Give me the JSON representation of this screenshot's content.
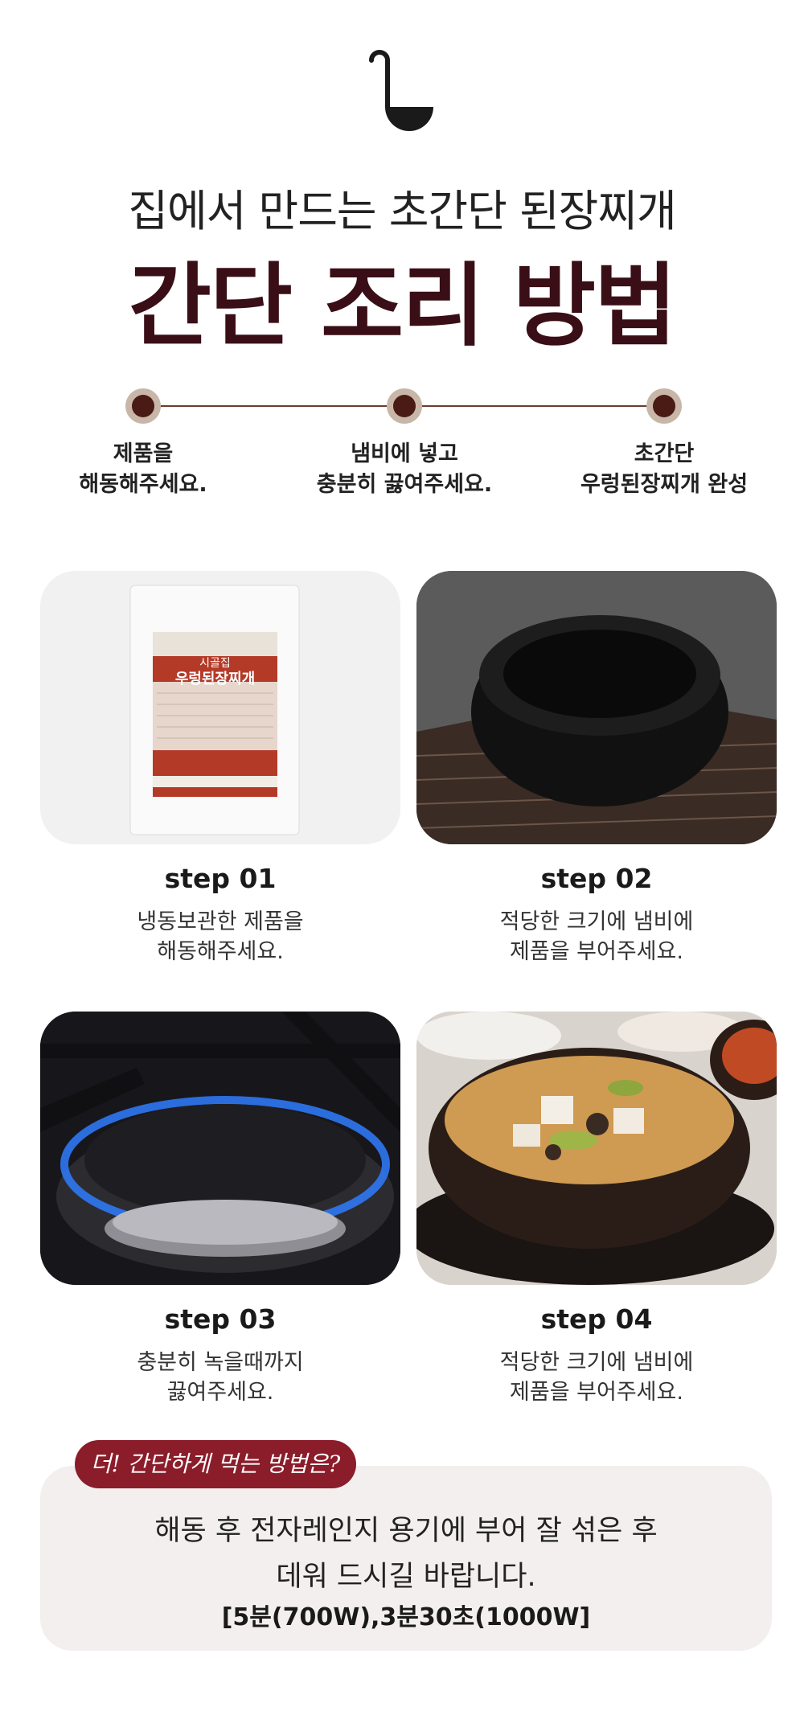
{
  "header": {
    "subtitle": "집에서 만드는 초간단 된장찌개",
    "title": "간단 조리 방법"
  },
  "timeline": [
    {
      "line1": "제품을",
      "line2": "해동해주세요."
    },
    {
      "line1": "냄비에 넣고",
      "line2": "충분히 끓여주세요."
    },
    {
      "line1": "초간단",
      "line2": "우렁된장찌개 완성"
    }
  ],
  "product": {
    "brand": "시골집",
    "name": "우렁된장찌개"
  },
  "steps": [
    {
      "title": "step 01",
      "line1": "냉동보관한 제품을",
      "line2": "해동해주세요."
    },
    {
      "title": "step 02",
      "line1": "적당한 크기에 냄비에",
      "line2": "제품을 부어주세요."
    },
    {
      "title": "step 03",
      "line1": "충분히 녹을때까지",
      "line2": "끓여주세요."
    },
    {
      "title": "step 04",
      "line1": "적당한 크기에 냄비에",
      "line2": "제품을 부어주세요."
    }
  ],
  "tip": {
    "badge": "더! 간단하게 먹는 방법은?",
    "line1": "해동 후 전자레인지 용기에 부어 잘 섞은 후",
    "line2": "데워 드시길 바랍니다.",
    "line3": "[5분(700W),3분30초(1000W]"
  },
  "colors": {
    "title": "#3a0e16",
    "accent": "#8b1c2a",
    "dot": "#4a1a14",
    "tipbox": "#f4efef"
  }
}
